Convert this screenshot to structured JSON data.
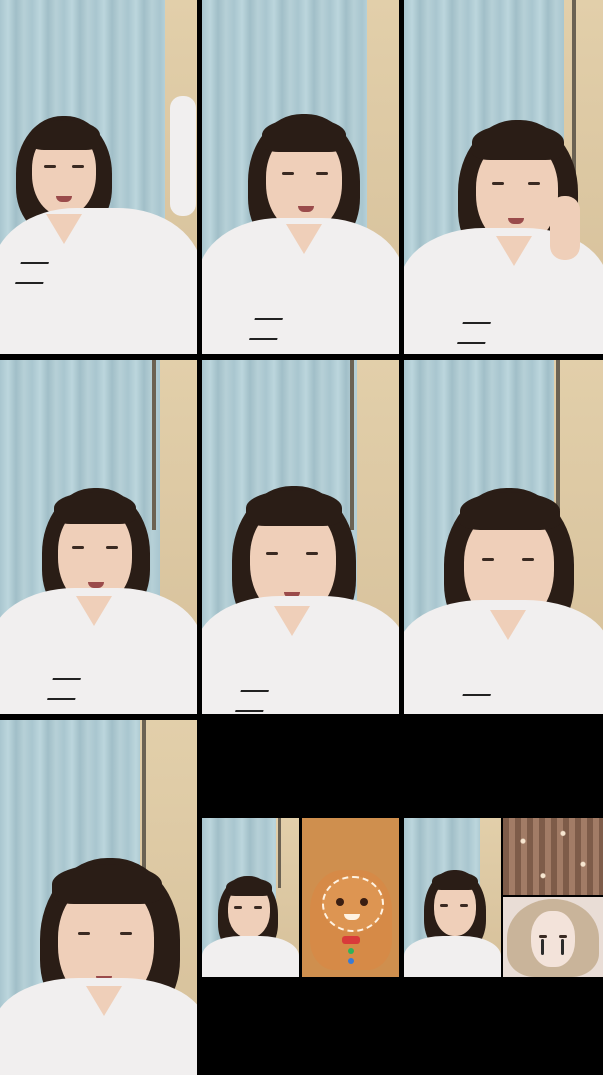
{
  "layout": "video-call-grid",
  "colors": {
    "background": "#000000",
    "curtain": "#a9c6cf",
    "wall": "#e2cfaa",
    "shirt": "#f1efef",
    "hair": "#2a1d16"
  },
  "tiles": [
    {
      "name": "video-tile-1"
    },
    {
      "name": "video-tile-2"
    },
    {
      "name": "video-tile-3"
    },
    {
      "name": "video-tile-4"
    },
    {
      "name": "video-tile-5"
    },
    {
      "name": "video-tile-6"
    },
    {
      "name": "video-tile-7"
    }
  ],
  "mini_tiles": [
    {
      "name": "mini-tile-self",
      "icon": "person-icon"
    },
    {
      "name": "mini-tile-gingerbread-filter",
      "icon": "gingerbread-icon"
    },
    {
      "name": "mini-tile-self-2",
      "icon": "person-icon"
    },
    {
      "name": "mini-tile-sparkle",
      "icon": "sparkle-icon"
    },
    {
      "name": "mini-tile-beauty-filter",
      "icon": "face-filter-icon"
    }
  ]
}
